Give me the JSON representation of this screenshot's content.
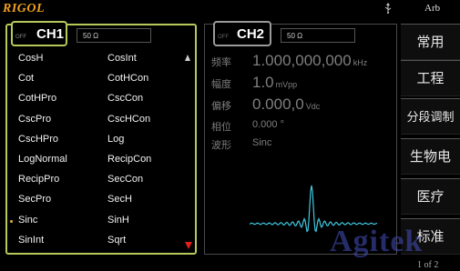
{
  "top_bar": {
    "brand": "RIGOL",
    "mode": "Arb",
    "usb_icon": "usb-icon"
  },
  "ch1": {
    "tab_label": "CH1",
    "state": "OFF",
    "impedance": "50 Ω",
    "waveforms_left": [
      "CosH",
      "Cot",
      "CotHPro",
      "CscPro",
      "CscHPro",
      "LogNormal",
      "RecipPro",
      "SecPro",
      "Sinc",
      "SinInt"
    ],
    "waveforms_right": [
      "CosInt",
      "CotHCon",
      "CscCon",
      "CscHCon",
      "Log",
      "RecipCon",
      "SecCon",
      "SecH",
      "SinH",
      "Sqrt"
    ],
    "selected": "Sinc"
  },
  "ch2": {
    "tab_label": "CH2",
    "state": "OFF",
    "impedance": "50 Ω",
    "params": {
      "freq_label": "频率",
      "freq_value": "1.000,000,000",
      "freq_unit": "kHz",
      "amp_label": "幅度",
      "amp_value": "1.0",
      "amp_unit": "mVpp",
      "offset_label": "偏移",
      "offset_value": "0.000,0",
      "offset_unit": "Vdc",
      "phase_label": "相位",
      "phase_value": "0.000 °",
      "wave_label": "波形",
      "wave_value": "Sinc"
    }
  },
  "softkeys": [
    "常用",
    "工程",
    "分段调制",
    "生物电",
    "医疗",
    "标准"
  ],
  "page_indicator": "1 of 2",
  "watermark": "Agitek",
  "colors": {
    "brand": "#f0a020",
    "ch1_border": "#b8c85a",
    "preview_wave": "#40c8e0",
    "scroll_down": "#e02020"
  }
}
